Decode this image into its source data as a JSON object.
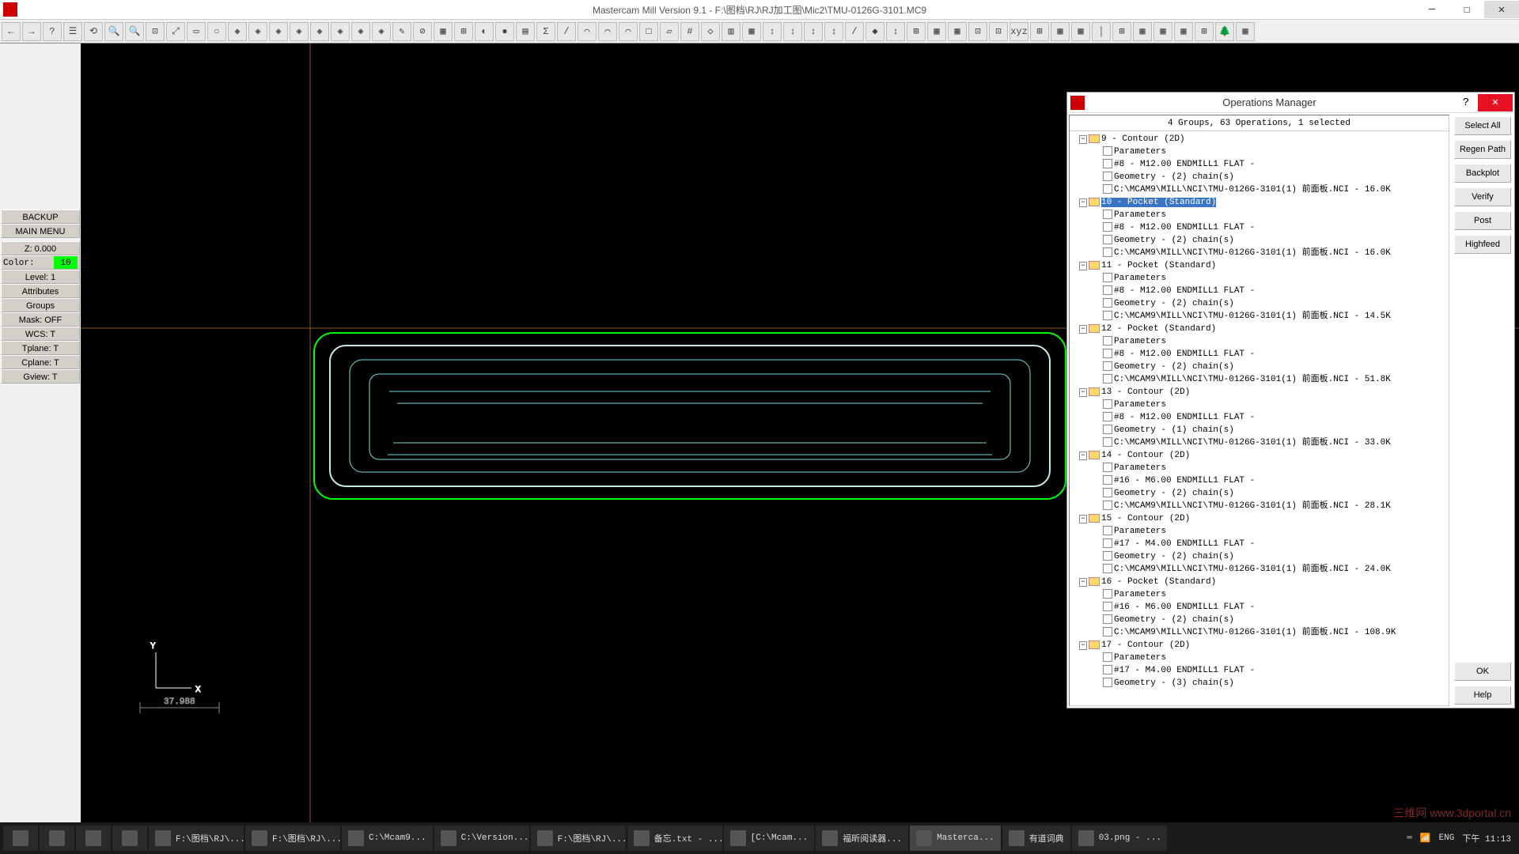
{
  "title": "Mastercam Mill Version 9.1 - F:\\图档\\RJ\\RJ加工图\\Mic2\\TMU-0126G-3101.MC9",
  "toolbar_icons": [
    "←",
    "→",
    "?",
    "☰",
    "⟲",
    "🔍",
    "🔍",
    "⊡",
    "⤢",
    "▭",
    "○",
    "◈",
    "◈",
    "◈",
    "◈",
    "◈",
    "◈",
    "◈",
    "◈",
    "✎",
    "⊘",
    "▦",
    "⊞",
    "◐",
    "●",
    "▤",
    "Σ",
    "/",
    "⌒",
    "⌒",
    "⌒",
    "□",
    "▱",
    "#",
    "◇",
    "▥",
    "▦",
    "↕",
    "↕",
    "↕",
    "↕",
    "/",
    "◆",
    "↕",
    "⊞",
    "▦",
    "▦",
    "⊡",
    "⊡",
    "xyz",
    "⊞",
    "▦",
    "▦",
    "│",
    "⊞",
    "▦",
    "▦",
    "▦",
    "⊞",
    "🌲",
    "▦"
  ],
  "left_panel": {
    "backup": "BACKUP",
    "main_menu": "MAIN MENU",
    "z": "Z:   0.000",
    "color_lbl": "Color:",
    "color_val": "10",
    "level": "Level:   1",
    "attributes": "Attributes",
    "groups": "Groups",
    "mask": "Mask:  OFF",
    "wcs": "WCS:    T",
    "tplane": "Tplane:   T",
    "cplane": "Cplane:   T",
    "gview": "Gview:   T"
  },
  "viewport": {
    "axis_y": "Y",
    "axis_x": "X",
    "scale": "37.988"
  },
  "ops": {
    "title": "Operations Manager",
    "status": "4 Groups, 63 Operations, 1 selected",
    "buttons": {
      "select_all": "Select All",
      "regen": "Regen Path",
      "backplot": "Backplot",
      "verify": "Verify",
      "post": "Post",
      "highfeed": "Highfeed",
      "ok": "OK",
      "help": "Help"
    },
    "groups": [
      {
        "id": "9",
        "name": "9 - Contour (2D)",
        "sel": false,
        "children": [
          "Parameters",
          "#8 - M12.00 ENDMILL1 FLAT -",
          "Geometry - (2) chain(s)",
          "C:\\MCAM9\\MILL\\NCI\\TMU-0126G-3101(1) 前面板.NCI - 16.0K"
        ]
      },
      {
        "id": "10",
        "name": "10 - Pocket (Standard)",
        "sel": true,
        "children": [
          "Parameters",
          "#8 - M12.00 ENDMILL1 FLAT -",
          "Geometry - (2) chain(s)",
          "C:\\MCAM9\\MILL\\NCI\\TMU-0126G-3101(1) 前面板.NCI - 16.0K"
        ]
      },
      {
        "id": "11",
        "name": "11 - Pocket (Standard)",
        "sel": false,
        "children": [
          "Parameters",
          "#8 - M12.00 ENDMILL1 FLAT -",
          "Geometry - (2) chain(s)",
          "C:\\MCAM9\\MILL\\NCI\\TMU-0126G-3101(1) 前面板.NCI - 14.5K"
        ]
      },
      {
        "id": "12",
        "name": "12 - Pocket (Standard)",
        "sel": false,
        "children": [
          "Parameters",
          "#8 - M12.00 ENDMILL1 FLAT -",
          "Geometry - (2) chain(s)",
          "C:\\MCAM9\\MILL\\NCI\\TMU-0126G-3101(1) 前面板.NCI - 51.8K"
        ]
      },
      {
        "id": "13",
        "name": "13 - Contour (2D)",
        "sel": false,
        "children": [
          "Parameters",
          "#8 - M12.00 ENDMILL1 FLAT -",
          "Geometry - (1) chain(s)",
          "C:\\MCAM9\\MILL\\NCI\\TMU-0126G-3101(1) 前面板.NCI - 33.0K"
        ]
      },
      {
        "id": "14",
        "name": "14 - Contour (2D)",
        "sel": false,
        "children": [
          "Parameters",
          "#16 - M6.00 ENDMILL1 FLAT -",
          "Geometry - (2) chain(s)",
          "C:\\MCAM9\\MILL\\NCI\\TMU-0126G-3101(1) 前面板.NCI - 28.1K"
        ]
      },
      {
        "id": "15",
        "name": "15 - Contour (2D)",
        "sel": false,
        "children": [
          "Parameters",
          "#17 - M4.00 ENDMILL1 FLAT -",
          "Geometry - (2) chain(s)",
          "C:\\MCAM9\\MILL\\NCI\\TMU-0126G-3101(1) 前面板.NCI - 24.0K"
        ]
      },
      {
        "id": "16",
        "name": "16 - Pocket (Standard)",
        "sel": false,
        "children": [
          "Parameters",
          "#16 - M6.00 ENDMILL1 FLAT -",
          "Geometry - (2) chain(s)",
          "C:\\MCAM9\\MILL\\NCI\\TMU-0126G-3101(1) 前面板.NCI - 108.9K"
        ]
      },
      {
        "id": "17",
        "name": "17 - Contour (2D)",
        "sel": false,
        "children": [
          "Parameters",
          "#17 - M4.00 ENDMILL1 FLAT -",
          "Geometry - (3) chain(s)"
        ]
      }
    ]
  },
  "taskbar": {
    "items": [
      {
        "label": "",
        "icon": "win"
      },
      {
        "label": "",
        "icon": "exp"
      },
      {
        "label": "",
        "icon": "chrome"
      },
      {
        "label": "",
        "icon": "app"
      },
      {
        "label": "F:\\图档\\RJ\\..."
      },
      {
        "label": "F:\\图档\\RJ\\..."
      },
      {
        "label": "C:\\Mcam9..."
      },
      {
        "label": "C:\\Version..."
      },
      {
        "label": "F:\\图档\\RJ\\..."
      },
      {
        "label": "备忘.txt - ..."
      },
      {
        "label": "[C:\\Mcam..."
      },
      {
        "label": "福昕阅读器..."
      },
      {
        "label": "Masterca...",
        "active": true
      },
      {
        "label": "有道词典"
      },
      {
        "label": "03.png - ..."
      }
    ],
    "lang": "ENG",
    "time": "下午 11:13"
  },
  "watermark": "三维网 www.3dportal.cn"
}
